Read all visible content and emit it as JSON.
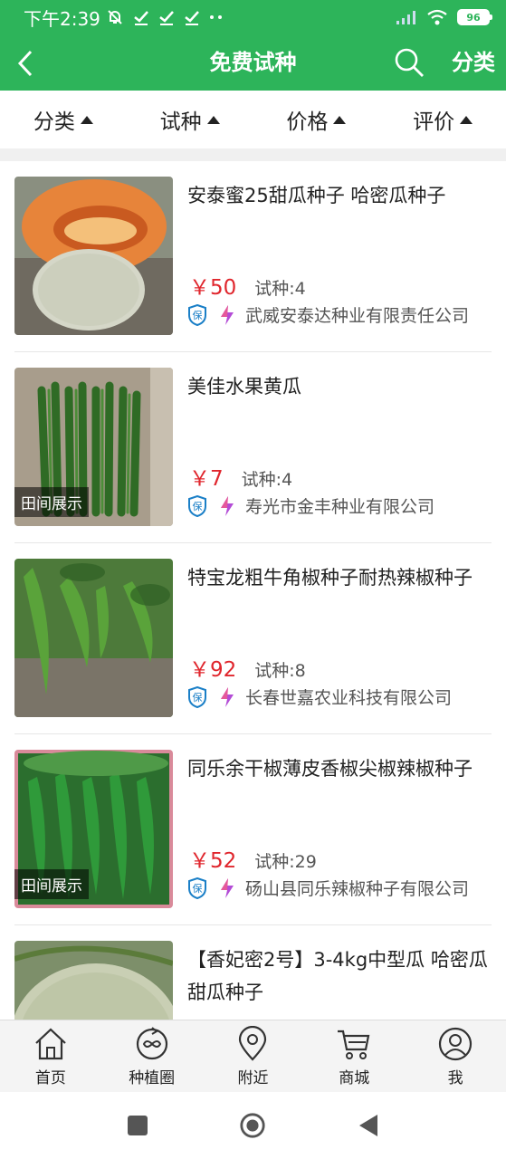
{
  "status_bar": {
    "time": "下午2:39",
    "battery": "96"
  },
  "header": {
    "title": "免费试种",
    "right_label": "分类"
  },
  "filters": [
    {
      "label": "分类"
    },
    {
      "label": "试种"
    },
    {
      "label": "价格"
    },
    {
      "label": "评价"
    }
  ],
  "products": [
    {
      "name": "安泰蜜25甜瓜种子 哈密瓜种子",
      "price": "￥50",
      "trial": "试种:4",
      "seller": "武威安泰达种业有限责任公司",
      "tag": ""
    },
    {
      "name": "美佳水果黄瓜",
      "price": "￥7",
      "trial": "试种:4",
      "seller": "寿光市金丰种业有限公司",
      "tag": "田间展示"
    },
    {
      "name": "特宝龙粗牛角椒种子耐热辣椒种子",
      "price": "￥92",
      "trial": "试种:8",
      "seller": "长春世嘉农业科技有限公司",
      "tag": ""
    },
    {
      "name": "同乐余干椒薄皮香椒尖椒辣椒种子",
      "price": "￥52",
      "trial": "试种:29",
      "seller": "砀山县同乐辣椒种子有限公司",
      "tag": "田间展示"
    },
    {
      "name": "【香妃密2号】3-4kg中型瓜 哈密瓜甜瓜种子",
      "price": "",
      "trial": "",
      "seller": "",
      "tag": ""
    }
  ],
  "badges": {
    "guarantee": "保"
  },
  "bottom_nav": [
    {
      "label": "首页",
      "icon": "home-icon"
    },
    {
      "label": "种植圈",
      "icon": "circle-icon"
    },
    {
      "label": "附近",
      "icon": "location-icon"
    },
    {
      "label": "商城",
      "icon": "cart-icon"
    },
    {
      "label": "我",
      "icon": "user-icon"
    }
  ],
  "colors": {
    "brand": "#2db45a",
    "price": "#e0262d"
  }
}
